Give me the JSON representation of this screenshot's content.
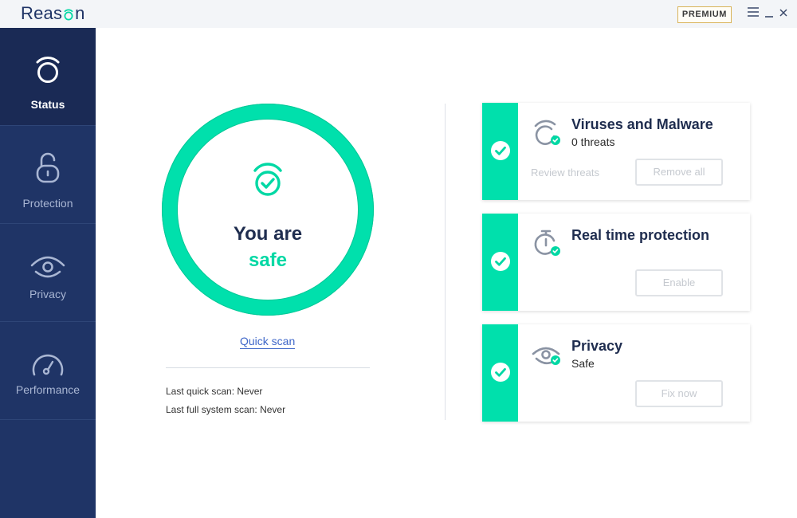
{
  "app": {
    "logo_text_prefix": "Reas",
    "logo_text_suffix": "n"
  },
  "header": {
    "premium_label": "PREMIUM"
  },
  "sidebar": {
    "items": [
      {
        "label": "Status",
        "icon": "status-icon",
        "active": true
      },
      {
        "label": "Protection",
        "icon": "lock-icon",
        "active": false
      },
      {
        "label": "Privacy",
        "icon": "eye-icon",
        "active": false
      },
      {
        "label": "Performance",
        "icon": "gauge-icon",
        "active": false
      }
    ]
  },
  "status": {
    "line1": "You are",
    "line2": "safe",
    "quick_scan_label": "Quick scan",
    "last_quick_scan_label": "Last quick scan:",
    "last_quick_scan_value": "Never",
    "last_full_scan_label": "Last full system scan:",
    "last_full_scan_value": "Never"
  },
  "cards": {
    "viruses": {
      "title": "Viruses and Malware",
      "subtitle": "0 threats",
      "link_label": "Review threats",
      "button_label": "Remove all"
    },
    "realtime": {
      "title": "Real time protection",
      "button_label": "Enable"
    },
    "privacy": {
      "title": "Privacy",
      "subtitle": "Safe",
      "button_label": "Fix now"
    }
  },
  "colors": {
    "sidebar": "#1f3466",
    "sidebar_active": "#1a2a55",
    "accent": "#00e0ac",
    "link": "#3f67c9",
    "premium_border": "#d9b45a"
  }
}
